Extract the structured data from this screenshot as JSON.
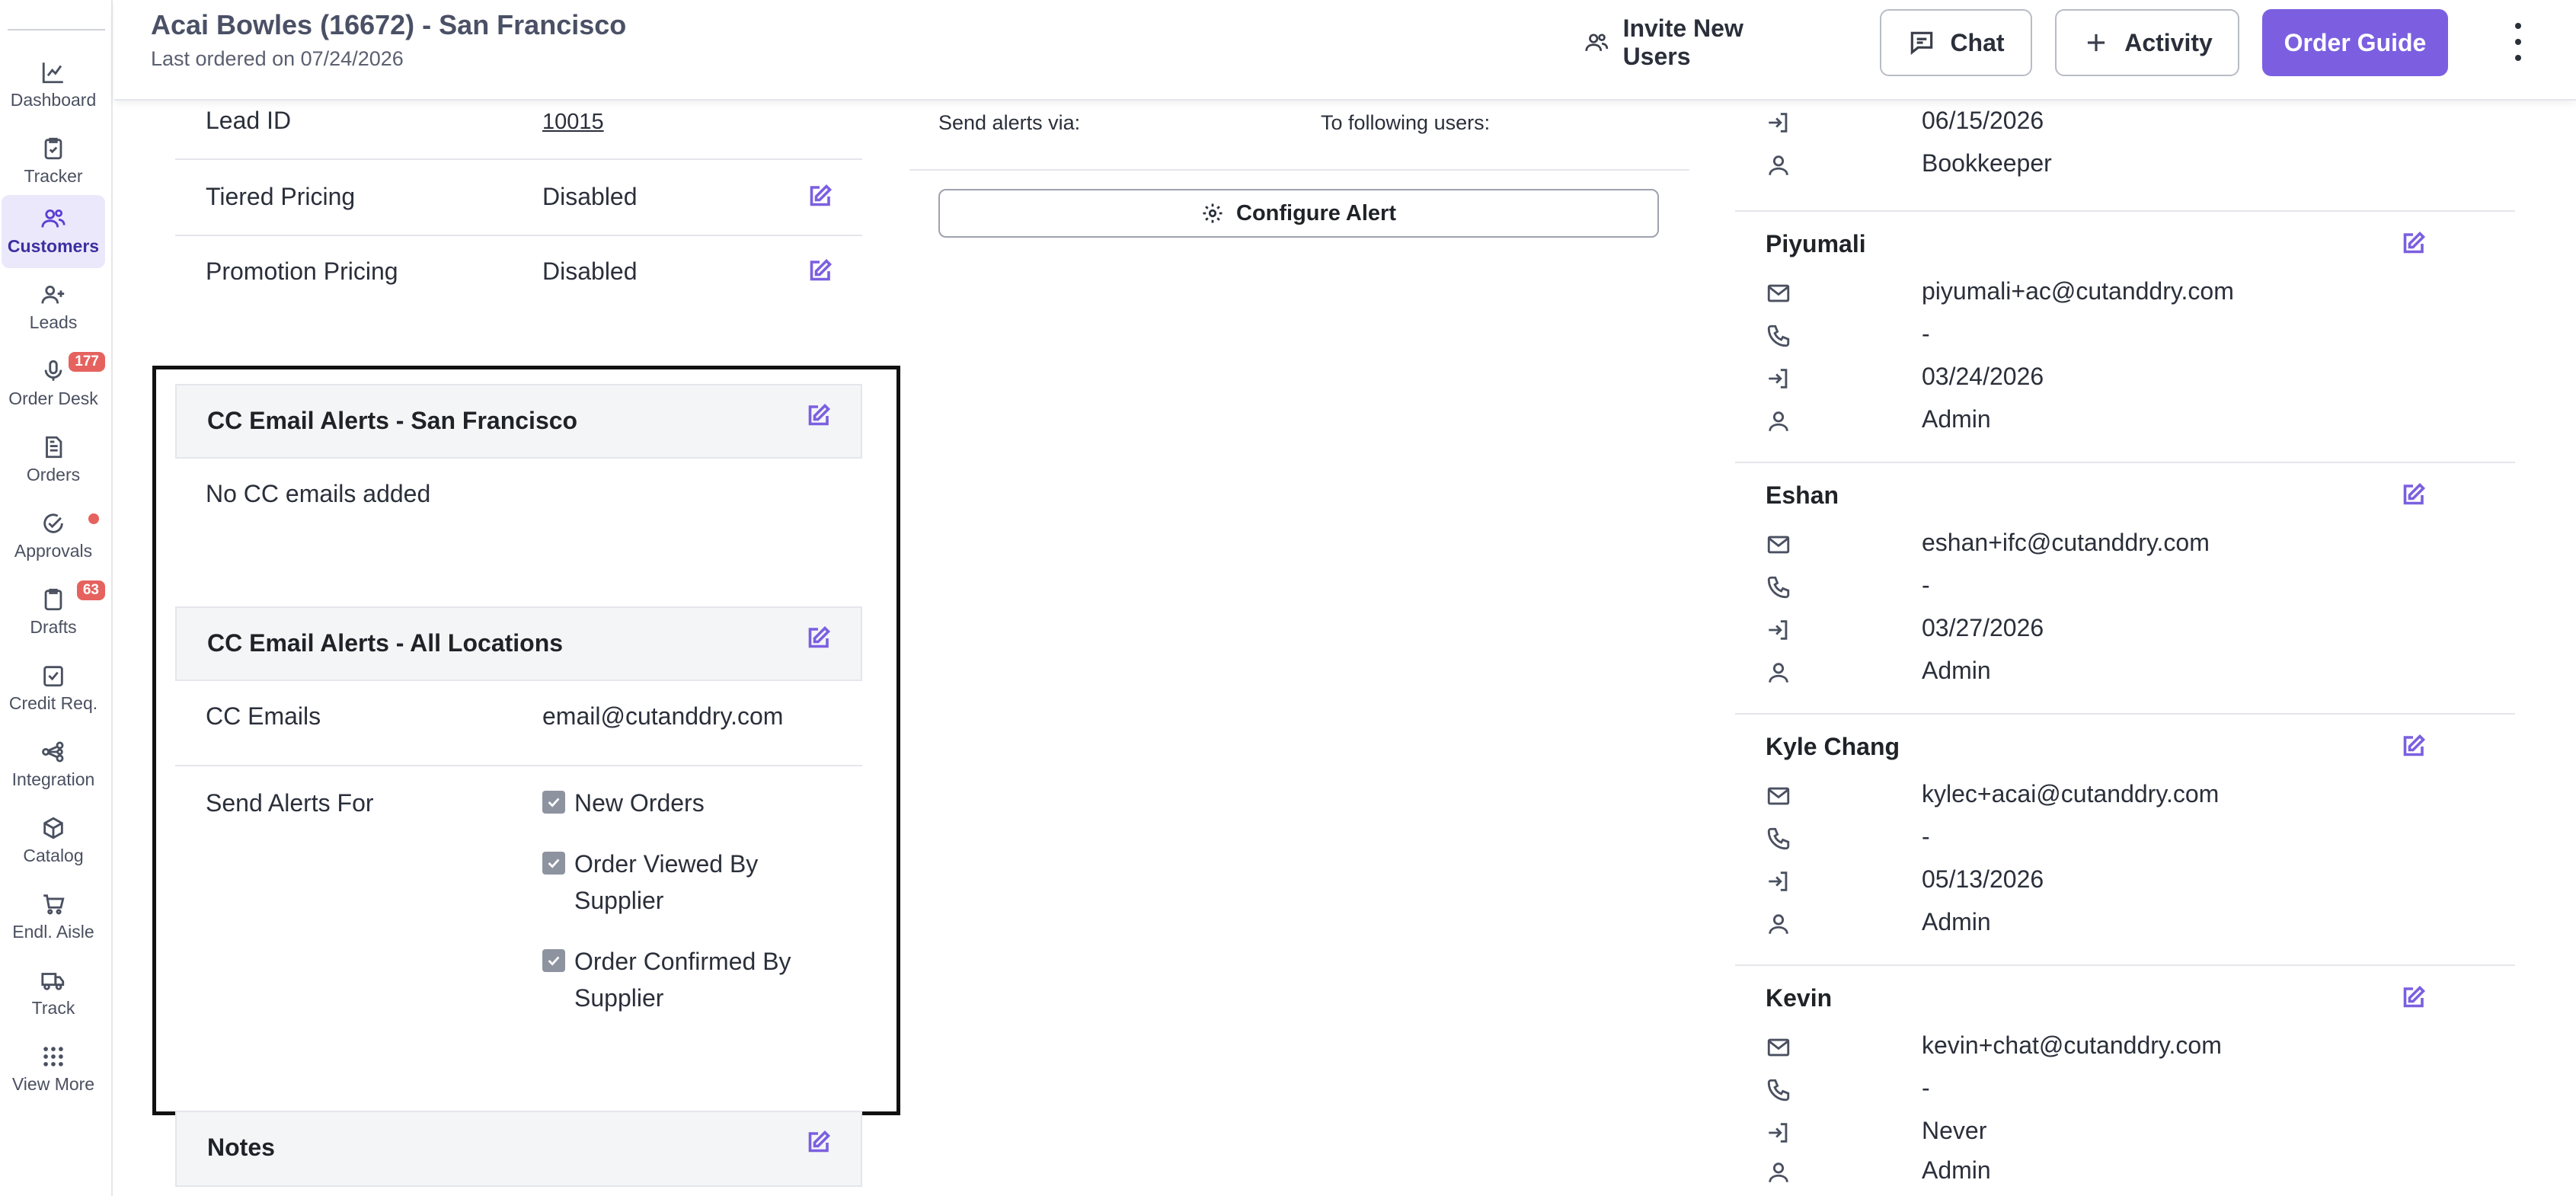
{
  "sidebar": {
    "items": [
      {
        "label": "Dashboard",
        "icon": "chart-line-icon"
      },
      {
        "label": "Tracker",
        "icon": "clipboard-check-icon"
      },
      {
        "label": "Customers",
        "icon": "users-icon",
        "active": true
      },
      {
        "label": "Leads",
        "icon": "user-plus-icon"
      },
      {
        "label": "Order Desk",
        "icon": "microphone-icon",
        "badge": "177"
      },
      {
        "label": "Orders",
        "icon": "document-icon"
      },
      {
        "label": "Approvals",
        "icon": "check-circle-icon",
        "dot": true
      },
      {
        "label": "Drafts",
        "icon": "clipboard-icon",
        "badge": "63"
      },
      {
        "label": "Credit Req.",
        "icon": "credit-check-icon"
      },
      {
        "label": "Integration",
        "icon": "network-icon"
      },
      {
        "label": "Catalog",
        "icon": "box-icon"
      },
      {
        "label": "Endl. Aisle",
        "icon": "cart-icon"
      },
      {
        "label": "Track",
        "icon": "truck-icon"
      },
      {
        "label": "View More",
        "icon": "grid-dots-icon"
      }
    ]
  },
  "header": {
    "title": "Acai Bowles (16672) - San Francisco",
    "subtitle": "Last ordered on 07/24/2026",
    "invite_label": "Invite New Users",
    "chat_label": "Chat",
    "activity_label": "Activity",
    "order_guide_label": "Order Guide"
  },
  "details": {
    "lead_id_label": "Lead ID",
    "lead_id_value": "10015",
    "tiered_label": "Tiered Pricing",
    "tiered_value": "Disabled",
    "promo_label": "Promotion Pricing",
    "promo_value": "Disabled"
  },
  "cc_location": {
    "title": "CC Email Alerts - San Francisco",
    "empty_text": "No CC emails added"
  },
  "cc_all": {
    "title": "CC Email Alerts - All Locations",
    "emails_label": "CC Emails",
    "emails_value": "email@cutanddry.com",
    "alerts_label": "Send Alerts For",
    "alerts": [
      {
        "label_line1": "New Orders",
        "label_line2": "",
        "checked": true
      },
      {
        "label_line1": "Order Viewed By",
        "label_line2": "Supplier",
        "checked": true
      },
      {
        "label_line1": "Order Confirmed By",
        "label_line2": "Supplier",
        "checked": true
      }
    ]
  },
  "notes": {
    "title": "Notes"
  },
  "alerts_config": {
    "send_via_label": "Send alerts via:",
    "users_label": "To following users:",
    "configure_label": "Configure Alert"
  },
  "users": {
    "partial": {
      "last_login": "06/15/2026",
      "role": "Bookkeeper"
    },
    "list": [
      {
        "name": "Piyumali",
        "email": "piyumali+ac@cutanddry.com",
        "phone": "-",
        "last_login": "03/24/2026",
        "role": "Admin"
      },
      {
        "name": "Eshan",
        "email": "eshan+ifc@cutanddry.com",
        "phone": "-",
        "last_login": "03/27/2026",
        "role": "Admin"
      },
      {
        "name": "Kyle Chang",
        "email": "kylec+acai@cutanddry.com",
        "phone": "-",
        "last_login": "05/13/2026",
        "role": "Admin"
      },
      {
        "name": "Kevin",
        "email": "kevin+chat@cutanddry.com",
        "phone": "-",
        "last_login": "Never",
        "role": "Admin"
      }
    ]
  },
  "colors": {
    "accent": "#7b5fe0",
    "badge": "#e5625e",
    "active_bg": "#ebe8fb"
  }
}
